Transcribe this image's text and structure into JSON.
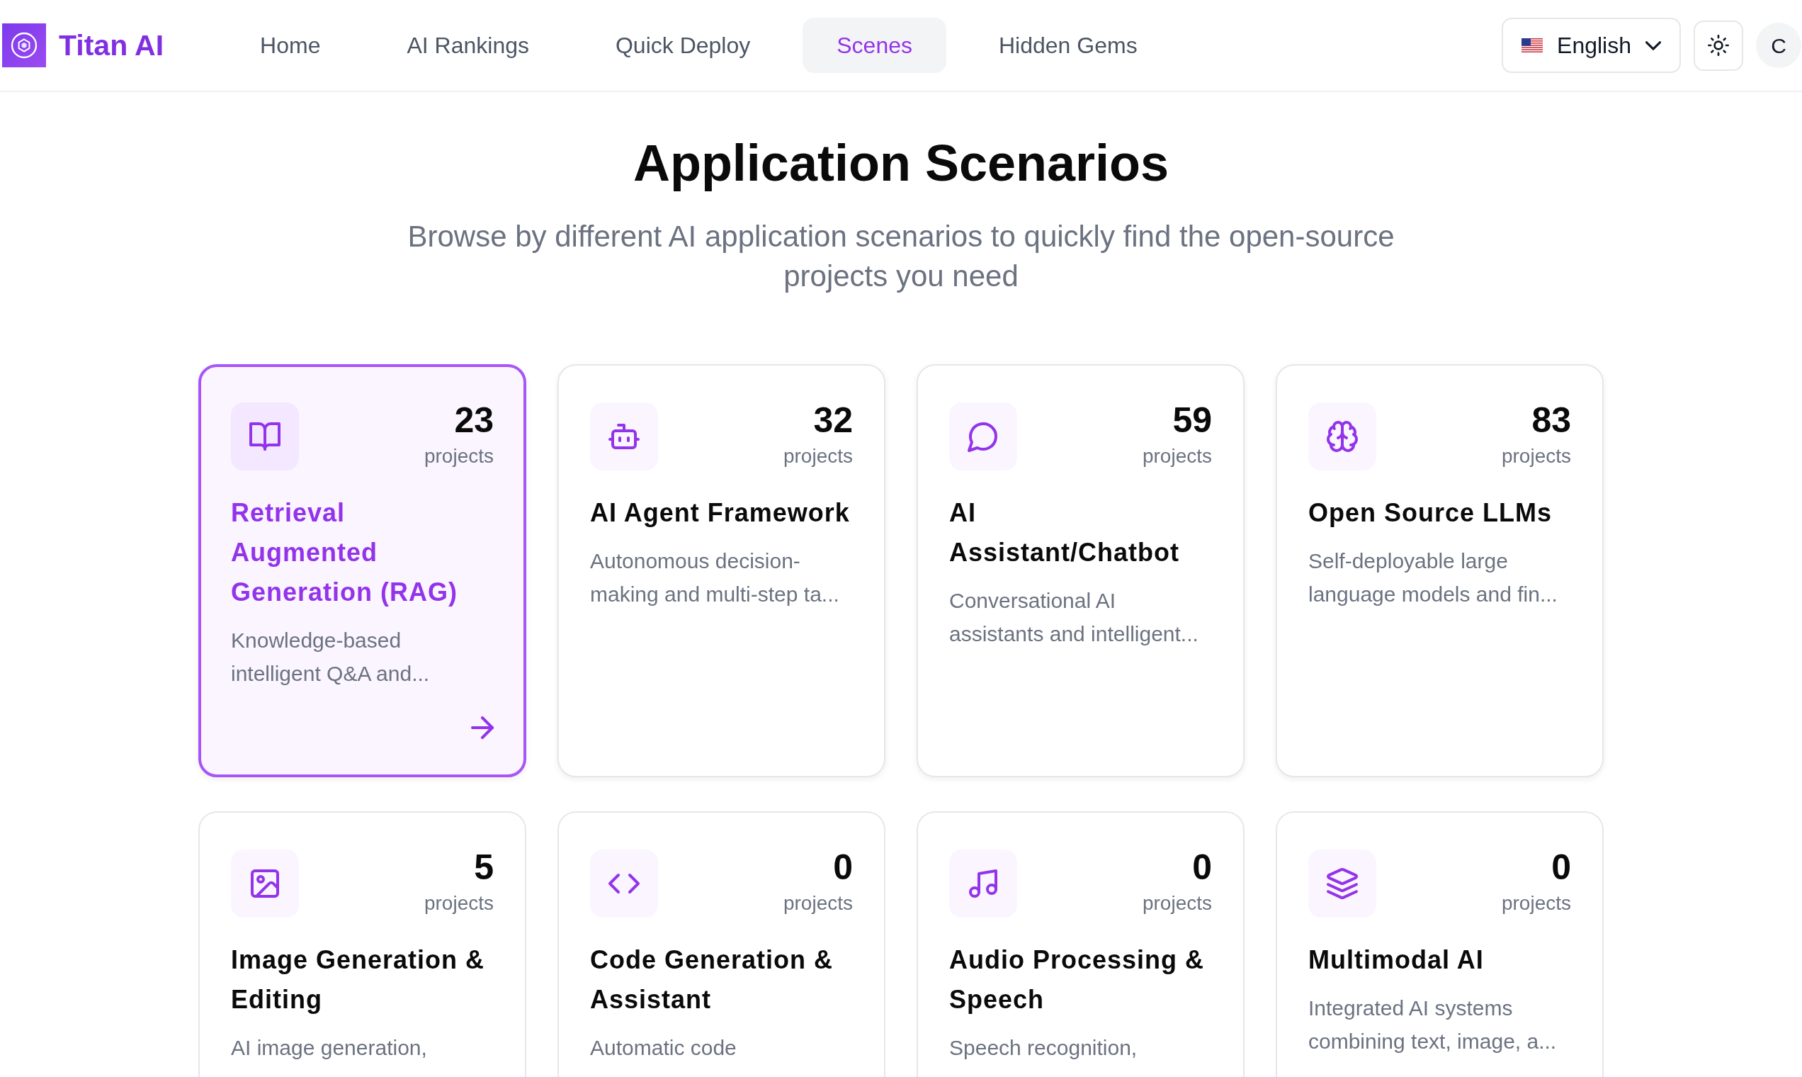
{
  "header": {
    "brand": "Titan AI",
    "nav": [
      {
        "label": "Home",
        "selected": false
      },
      {
        "label": "AI Rankings",
        "selected": false
      },
      {
        "label": "Quick Deploy",
        "selected": false
      },
      {
        "label": "Scenes",
        "selected": true
      },
      {
        "label": "Hidden Gems",
        "selected": false
      }
    ],
    "language": "English",
    "avatar": "C"
  },
  "intro": {
    "title": "Application Scenarios",
    "subtitle": "Browse by different AI application scenarios to quickly find the open-source projects you need"
  },
  "scenarios": [
    {
      "kind": "book",
      "count": "23",
      "count_label": "projects",
      "title": "Retrieval Augmented Generation (RAG)",
      "description": "Knowledge-based intelligent Q&A and...",
      "selected": true
    },
    {
      "kind": "robot",
      "count": "32",
      "count_label": "projects",
      "title": "AI Agent Framework",
      "description": "Autonomous decision-making and multi-step ta...",
      "selected": false
    },
    {
      "kind": "chat",
      "count": "59",
      "count_label": "projects",
      "title": "AI Assistant/Chatbot",
      "description": "Conversational AI assistants and intelligent...",
      "selected": false
    },
    {
      "kind": "brain",
      "count": "83",
      "count_label": "projects",
      "title": "Open Source LLMs",
      "description": "Self-deployable large language models and fin...",
      "selected": false
    },
    {
      "kind": "picture",
      "count": "5",
      "count_label": "projects",
      "title": "Image Generation & Editing",
      "description": "AI image generation,",
      "selected": false
    },
    {
      "kind": "code",
      "count": "0",
      "count_label": "projects",
      "title": "Code Generation & Assistant",
      "description": "Automatic code",
      "selected": false
    },
    {
      "kind": "music",
      "count": "0",
      "count_label": "projects",
      "title": "Audio Processing & Speech",
      "description": "Speech recognition,",
      "selected": false
    },
    {
      "kind": "layers",
      "count": "0",
      "count_label": "projects",
      "title": "Multimodal AI",
      "description": "Integrated AI systems combining text, image, a...",
      "selected": false
    }
  ]
}
